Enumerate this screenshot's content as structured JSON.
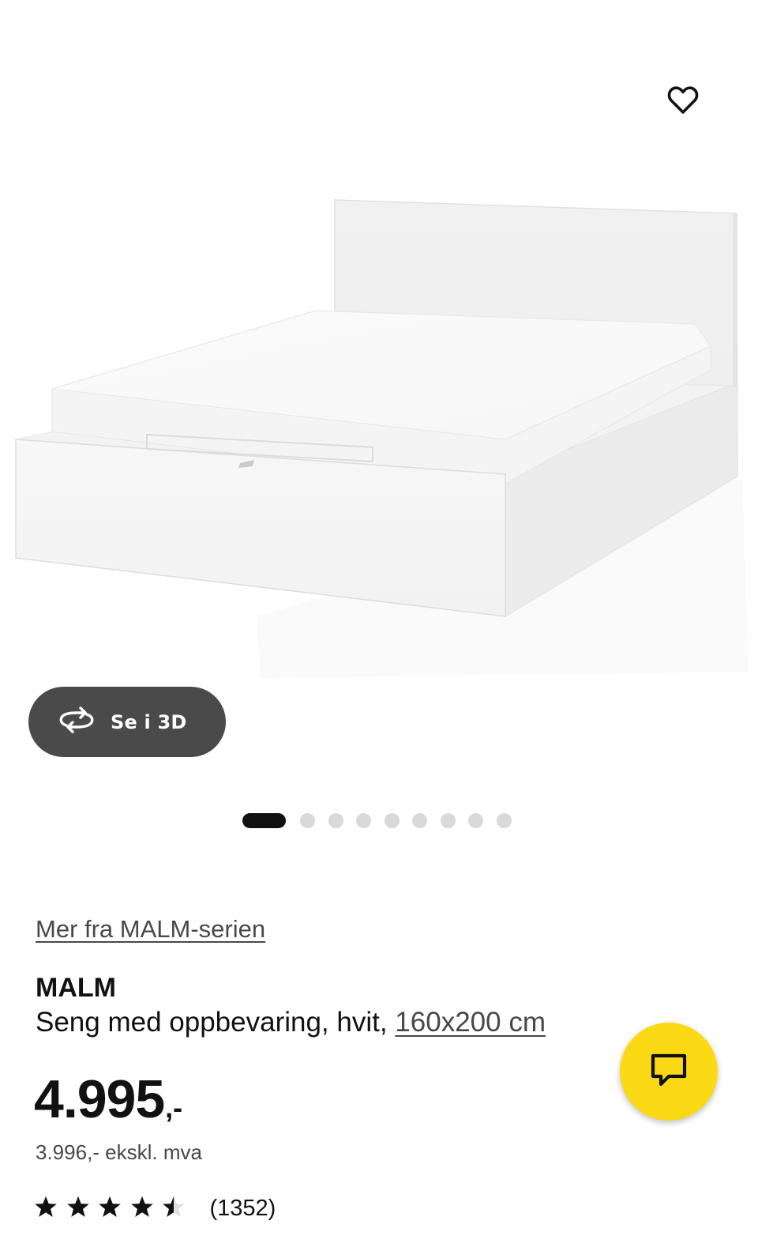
{
  "product": {
    "series_link": "Mer fra MALM-serien",
    "name": "MALM",
    "description": "Seng med oppbevaring, hvit, ",
    "size": "160x200 cm",
    "price": "4.995",
    "price_suffix": ",-",
    "price_excl_vat": "3.996,- ekskl. mva",
    "rating": {
      "stars": 4.5,
      "max": 5,
      "count_label": "(1352)"
    }
  },
  "view_3d": {
    "label": "Se i 3D",
    "icon": "rotate-3d-icon"
  },
  "carousel": {
    "total": 9,
    "active_index": 0
  },
  "icons": {
    "favorite": "heart-icon",
    "chat": "chat-bubble-icon",
    "star": "star-icon"
  },
  "colors": {
    "chat_button": "#fbd914",
    "view_3d_button": "#4a4a4a",
    "active_dot": "#111111",
    "inactive_dot": "#d9d9d9"
  }
}
